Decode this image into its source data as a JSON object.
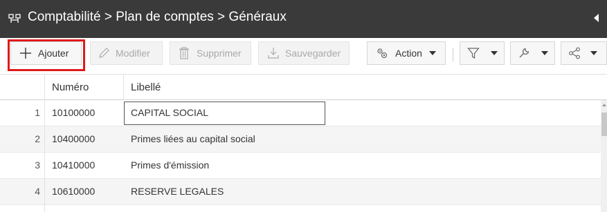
{
  "window": {
    "breadcrumb": "Comptabilité > Plan de comptes > Généraux",
    "tree_icon": "hierarchy-icon",
    "collapse_icon": "triangle-left-icon"
  },
  "toolbar": {
    "add_label": "Ajouter",
    "edit_label": "Modifier",
    "delete_label": "Supprimer",
    "save_label": "Sauvegarder",
    "action_label": "Action",
    "highlight_color": "#e0191b"
  },
  "table": {
    "columns": [
      "Numéro",
      "Libellé"
    ],
    "rows": [
      {
        "index": "1",
        "numero": "10100000",
        "libelle": "CAPITAL SOCIAL"
      },
      {
        "index": "2",
        "numero": "10400000",
        "libelle": "Primes liées au capital social"
      },
      {
        "index": "3",
        "numero": "10410000",
        "libelle": "Primes d'émission"
      },
      {
        "index": "4",
        "numero": "10610000",
        "libelle": "RESERVE LEGALES"
      }
    ]
  }
}
